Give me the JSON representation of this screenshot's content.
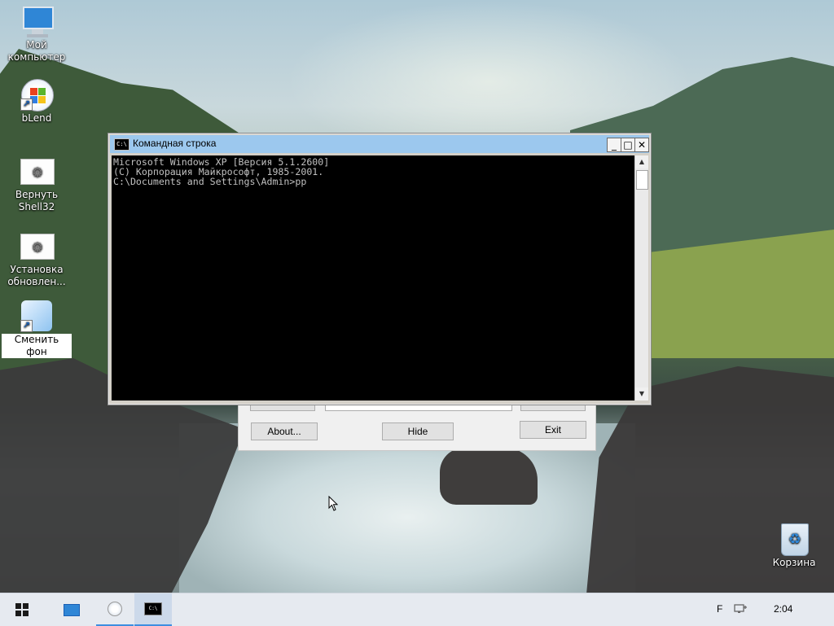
{
  "desktop": {
    "icons": [
      {
        "label": "Мой компьютер",
        "icon": "computer-icon"
      },
      {
        "label": "bLend",
        "icon": "windows-xp-icon"
      },
      {
        "label": "Вернуть Shell32",
        "icon": "settings-gear-icon"
      },
      {
        "label": "Установка обновлен...",
        "icon": "settings-gear-icon"
      },
      {
        "label": "Сменить фон",
        "icon": "change-wallpaper-icon"
      },
      {
        "label": "Корзина",
        "icon": "recycle-bin-icon"
      }
    ]
  },
  "dialog": {
    "about_label": "About...",
    "hide_label": "Hide",
    "exit_label": "Exit"
  },
  "console": {
    "title": "Командная строка",
    "icon_text": "C:\\",
    "minimize": "_",
    "maximize": "□",
    "close": "✕",
    "lines": [
      "Microsoft Windows XP [Версия 5.1.2600]",
      "(С) Корпорация Майкрософт, 1985-2001.",
      "",
      "C:\\Documents and Settings\\Admin>pp"
    ]
  },
  "taskbar": {
    "tray_letter": "F",
    "clock": "2:04",
    "cmd_icon_text": "C:\\"
  },
  "colors": {
    "titlebar": "#9cc8ee",
    "console_bg": "#000000",
    "console_fg": "#c0c0c0",
    "taskbar_bg": "#e6eaf0",
    "accent": "#3d8ee0"
  }
}
